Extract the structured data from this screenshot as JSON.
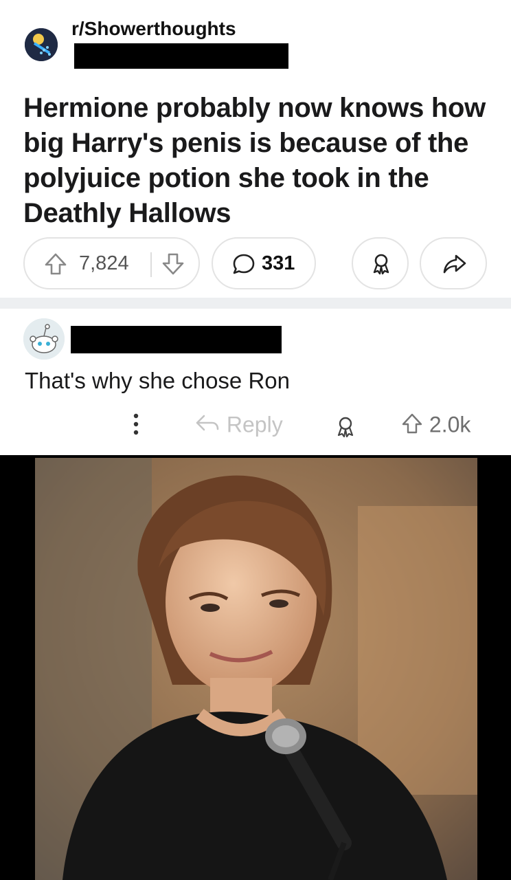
{
  "post": {
    "subreddit": "r/Showerthoughts",
    "title": "Hermione probably now knows how big Harry's penis is because of the polyjuice potion she took in the Deathly Hallows",
    "upvotes": "7,824",
    "comments": "331",
    "icons": [
      "subreddit-avatar-icon",
      "upvote-icon",
      "downvote-icon",
      "comment-bubble-icon",
      "award-icon",
      "share-icon"
    ]
  },
  "comment": {
    "text": "That's why she chose Ron",
    "reply_label": "Reply",
    "upvotes": "2.0k",
    "icons": [
      "snoo-avatar-icon",
      "more-options-icon",
      "reply-icon",
      "award-icon",
      "upvote-icon"
    ]
  },
  "colors": {
    "divider": "#edeff1",
    "muted": "#6e6e6e",
    "reply_disabled": "#c4c4c4",
    "pill_border": "#e3e3e3"
  }
}
